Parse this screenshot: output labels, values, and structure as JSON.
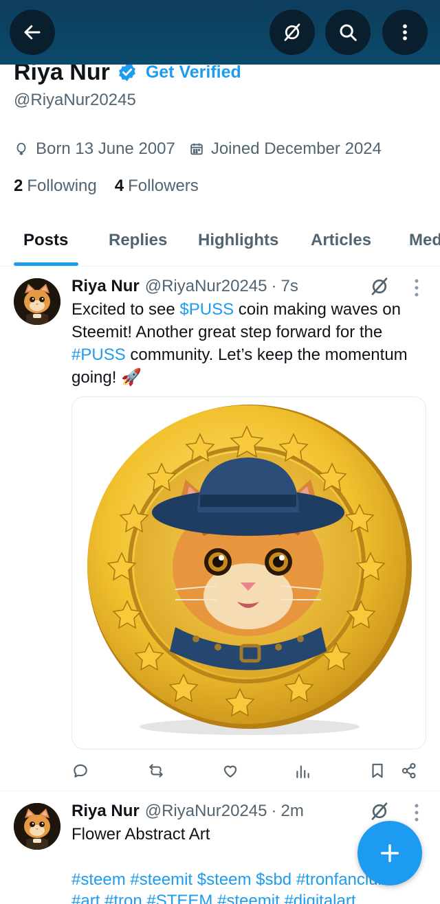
{
  "profile": {
    "name": "Riya Nur",
    "get_verified": "Get Verified",
    "handle": "@RiyaNur20245",
    "born": "Born 13 June 2007",
    "joined": "Joined December 2024",
    "following_count": "2",
    "following_label": "Following",
    "followers_count": "4",
    "followers_label": "Followers"
  },
  "tabs": [
    {
      "label": "Posts",
      "active": true
    },
    {
      "label": "Replies"
    },
    {
      "label": "Highlights"
    },
    {
      "label": "Articles"
    },
    {
      "label": "Med"
    }
  ],
  "posts": [
    {
      "name": "Riya Nur",
      "handle": "@RiyaNur20245",
      "sep": "·",
      "time": "7s",
      "text_1": "Excited to see ",
      "cashtag": "$PUSS",
      "text_2": " coin making waves on Steemit! Another great step forward for the ",
      "hashtag": "#PUSS",
      "text_3": " community. Let’s keep the momentum going! ",
      "emoji": "🚀"
    },
    {
      "name": "Riya Nur",
      "handle": "@RiyaNur20245",
      "sep": "·",
      "time": "2m",
      "text": "Flower Abstract Art",
      "tags_line_1": "#steem #steemit $steem $sbd #tronfanclub",
      "tags_line_2": "#art #tron #STEEM #steemit #digitalart"
    }
  ],
  "colors": {
    "header": "#0b4a6b",
    "accent": "#1d9bf0",
    "text": "#0f1419",
    "muted": "#536471",
    "coin_gold": "#f2c12e"
  },
  "icons": {
    "back": "arrow-left-icon",
    "grok": "grok-icon",
    "search": "search-icon",
    "more": "more-vertical-icon",
    "verified": "verified-badge-icon",
    "location": "balloon-icon",
    "calendar": "calendar-icon",
    "reply": "reply-icon",
    "retweet": "retweet-icon",
    "like": "heart-icon",
    "views": "analytics-icon",
    "bookmark": "bookmark-icon",
    "share": "share-icon",
    "compose": "plus-icon"
  }
}
